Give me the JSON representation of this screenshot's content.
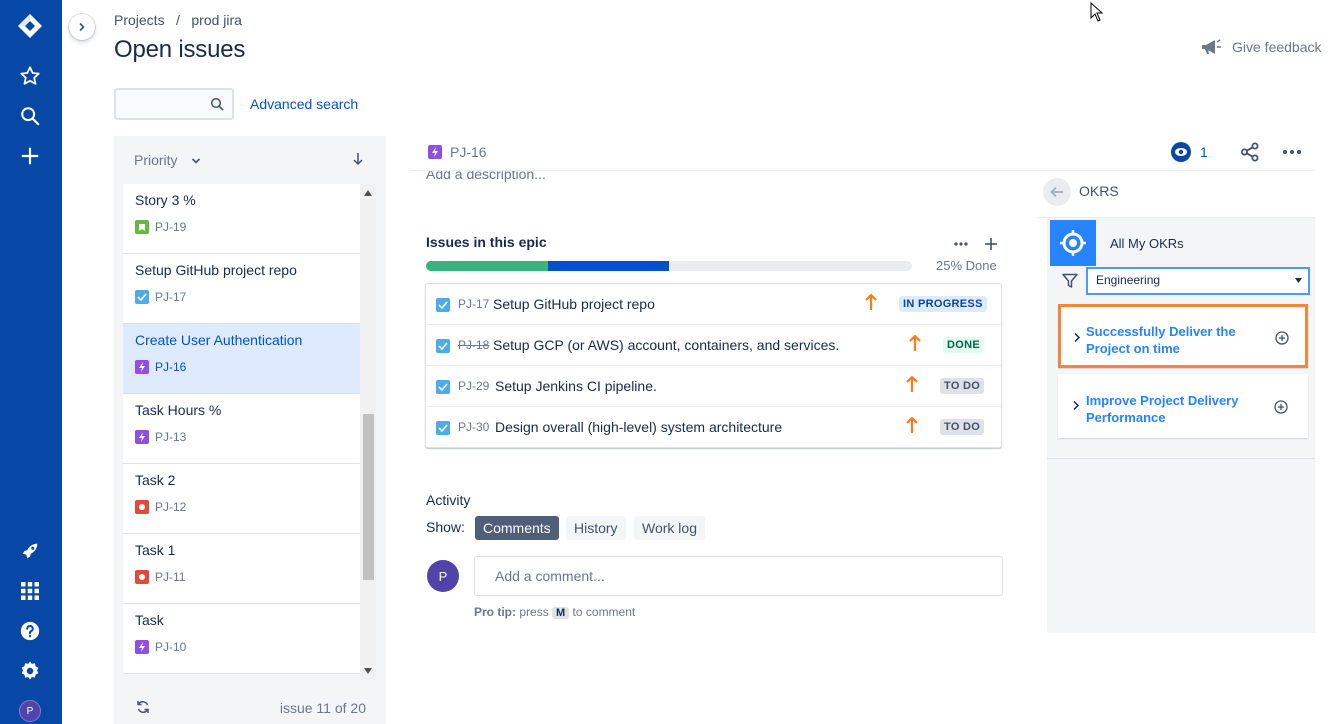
{
  "nav": {
    "icons": [
      "jira-logo-icon",
      "star-icon",
      "search-icon",
      "plus-icon",
      "rocket-icon",
      "apps-grid-icon",
      "help-icon",
      "settings-icon"
    ],
    "avatar_initial": "P",
    "color": "#0747a6"
  },
  "breadcrumb": {
    "projects": "Projects",
    "separator": "/",
    "project": "prod jira"
  },
  "page_title": "Open issues",
  "search": {
    "placeholder": "",
    "advanced_label": "Advanced search"
  },
  "feedback": {
    "label": "Give feedback"
  },
  "issue_list": {
    "sort_label": "Priority",
    "items": [
      {
        "title": "Story 3 %",
        "key": "PJ-19",
        "type": "story",
        "selected": false
      },
      {
        "title": "Setup GitHub project repo",
        "key": "PJ-17",
        "type": "task",
        "selected": false
      },
      {
        "title": "Create User Authentication",
        "key": "PJ-16",
        "type": "epic",
        "selected": true
      },
      {
        "title": "Task Hours %",
        "key": "PJ-13",
        "type": "epic",
        "selected": false
      },
      {
        "title": "Task 2",
        "key": "PJ-12",
        "type": "bug",
        "selected": false
      },
      {
        "title": "Task 1",
        "key": "PJ-11",
        "type": "bug",
        "selected": false
      },
      {
        "title": "Task",
        "key": "PJ-10",
        "type": "epic",
        "selected": false
      }
    ],
    "footer_count": "issue 11 of 20"
  },
  "detail": {
    "key": "PJ-16",
    "watchers": "1",
    "add_description": "Add a description...",
    "epic": {
      "title": "Issues in this epic",
      "progress_label": "25% Done",
      "progress": {
        "done": 0.25,
        "in_progress": 0.25
      },
      "rows": [
        {
          "key": "PJ-17",
          "summary": "Setup GitHub project repo",
          "status": "IN PROGRESS",
          "strike": false
        },
        {
          "key": "PJ-18",
          "summary": "Setup GCP (or AWS) account, containers, and services.",
          "status": "DONE",
          "strike": true
        },
        {
          "key": "PJ-29",
          "summary": "Setup Jenkins CI pipeline.",
          "status": "TO DO",
          "strike": false
        },
        {
          "key": "PJ-30",
          "summary": "Design overall (high-level) system architecture",
          "status": "TO DO",
          "strike": false
        }
      ]
    },
    "activity": {
      "title": "Activity",
      "show_label": "Show:",
      "tabs": [
        "Comments",
        "History",
        "Work log"
      ],
      "active_tab": "Comments",
      "avatar_initial": "P",
      "comment_placeholder": "Add a comment...",
      "protip_prefix": "Pro tip:",
      "protip_press": "press",
      "protip_key": "M",
      "protip_suffix": "to comment"
    }
  },
  "okr": {
    "title": "OKRS",
    "all_my": "All My OKRs",
    "filter_value": "Engineering",
    "cards": [
      {
        "text": "Successfully Deliver the Project on time",
        "highlighted": true
      },
      {
        "text": "Improve Project Delivery Performance",
        "highlighted": false
      }
    ],
    "accent": "#2684ff",
    "highlight": "#f5843d"
  }
}
